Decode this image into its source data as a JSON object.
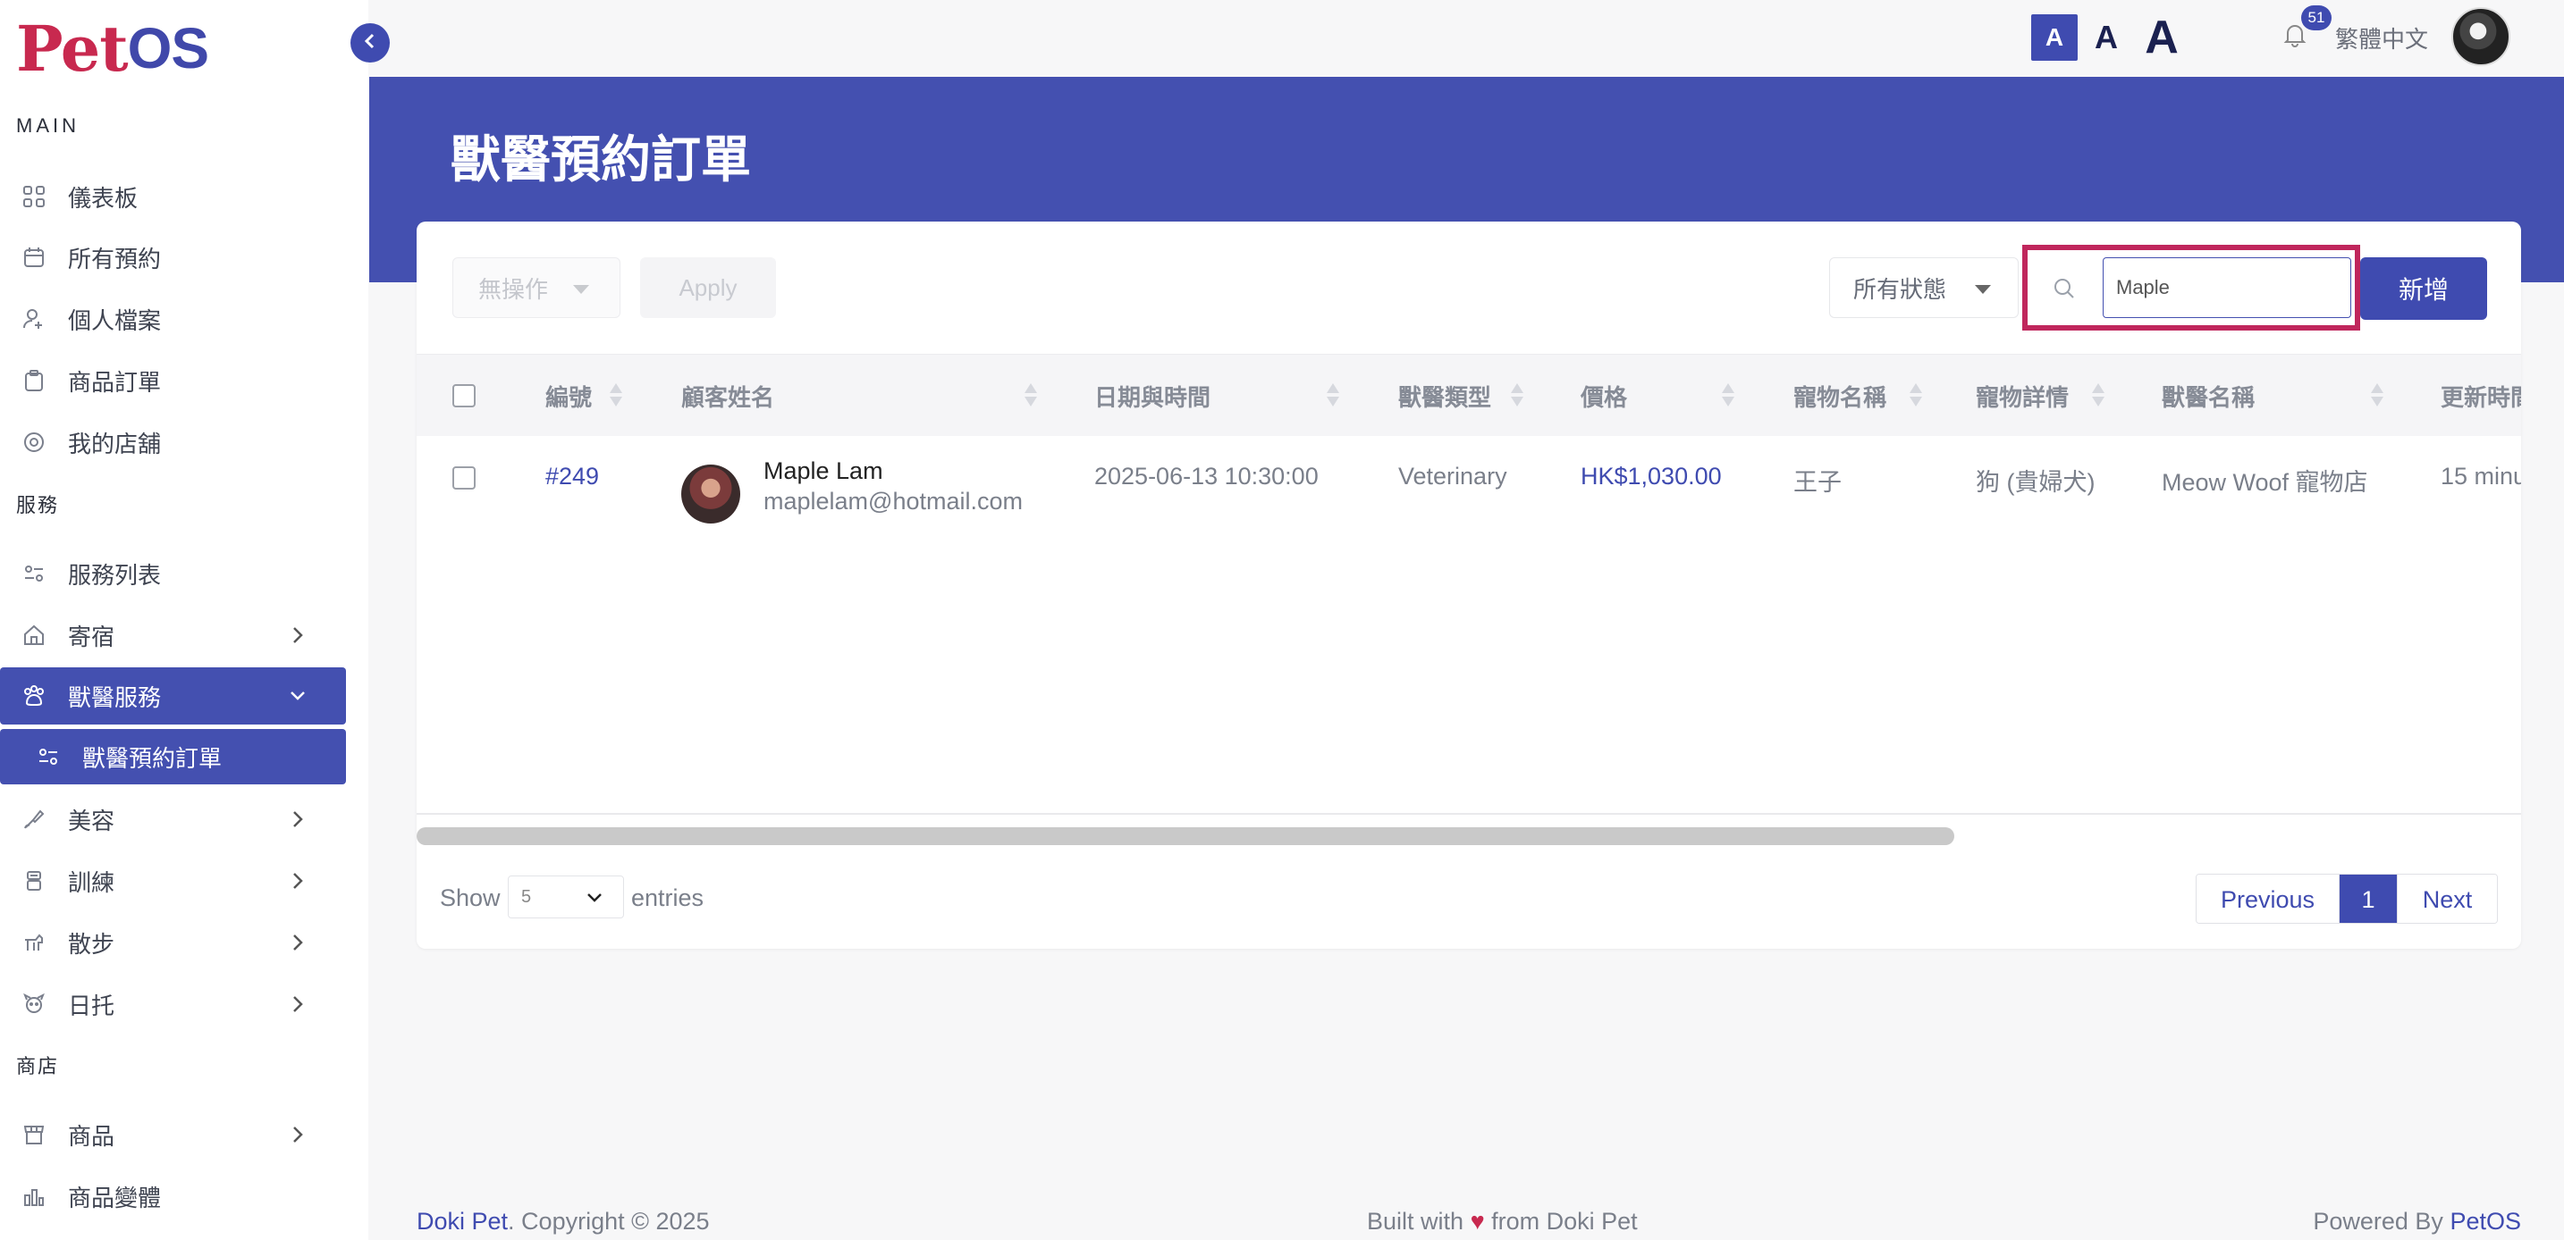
{
  "brand": {
    "logo_pet": "Pet",
    "logo_os": "OS"
  },
  "topbar": {
    "font_small": "A",
    "font_medium": "A",
    "font_large": "A",
    "notification_count": "51",
    "language": "繁體中文"
  },
  "sidebar": {
    "main_label": "MAIN",
    "services_label": "服務",
    "shop_label": "商店",
    "items": {
      "dashboard": "儀表板",
      "all_bookings": "所有預約",
      "profile": "個人檔案",
      "product_orders": "商品訂單",
      "my_store": "我的店舖",
      "service_list": "服務列表",
      "boarding": "寄宿",
      "vet_services": "獸醫服務",
      "vet_orders": "獸醫預約訂單",
      "grooming": "美容",
      "training": "訓練",
      "walking": "散步",
      "daycare": "日托",
      "products": "商品",
      "product_variants": "商品變體"
    }
  },
  "page": {
    "title": "獸醫預約訂單"
  },
  "toolbar": {
    "bulk_action": "無操作",
    "apply": "Apply",
    "status_filter": "所有狀態",
    "search_value": "Maple",
    "add": "新增"
  },
  "table": {
    "headers": {
      "id": "編號",
      "customer": "顧客姓名",
      "datetime": "日期與時間",
      "vet_type": "獸醫類型",
      "price": "價格",
      "pet_name": "寵物名稱",
      "pet_detail": "寵物詳情",
      "vet_name": "獸醫名稱",
      "updated": "更新時間"
    },
    "rows": [
      {
        "id": "#249",
        "customer_name": "Maple Lam",
        "customer_email": "maplelam@hotmail.com",
        "datetime": "2025-06-13 10:30:00",
        "vet_type": "Veterinary",
        "price": "HK$1,030.00",
        "pet_name": "王子",
        "pet_detail": "狗 (貴婦犬)",
        "vet_name": "Meow Woof 寵物店",
        "updated": "15 minu"
      }
    ]
  },
  "pagination": {
    "show": "Show",
    "page_size": "5",
    "entries": "entries",
    "previous": "Previous",
    "current": "1",
    "next": "Next"
  },
  "footer": {
    "company": "Doki Pet",
    "copyright": ". Copyright © 2025",
    "built_prefix": "Built with",
    "heart": "♥",
    "built_suffix": "from Doki Pet",
    "powered_prefix": "Powered By",
    "powered_brand": "PetOS"
  },
  "colors": {
    "primary": "#4450b0",
    "accent": "#c8294f",
    "highlight": "#c0265c"
  }
}
